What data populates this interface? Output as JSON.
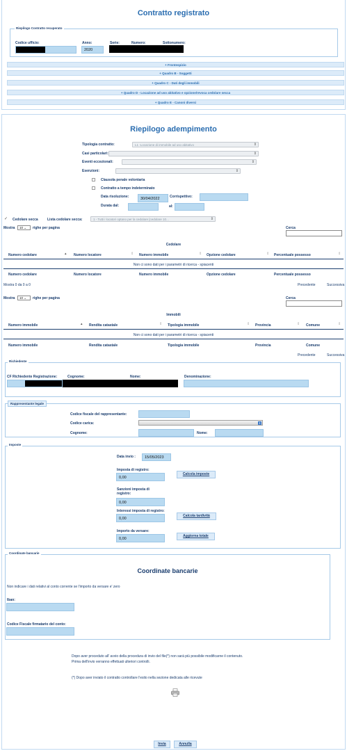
{
  "page": {
    "title": "Contratto registrato"
  },
  "riepilogo_contratto": {
    "legend": "Riepilogo Contratto recuperato",
    "codice_ufficio_label": "Codice ufficio:",
    "anno_label": "Anno:",
    "anno_value": "2020",
    "serie_label": "Serie:",
    "numero_label": "Numero:",
    "sottonumero_label": "Sottonumero:"
  },
  "accordions": [
    "+ Frontespizio",
    "+ Quadro B - Soggetti",
    "+ Quadro C - Dati degli immobili",
    "+ Quadro D - Locazione ad uso abitativo e opzione/revoca cedolare secca",
    "+ Quadro E - Canoni diversi"
  ],
  "adempimento": {
    "title": "Riepilogo adempimento",
    "tipologia_label": "Tipologia contratto:",
    "tipologia_value": "L1 -Locazione di immobile ad uso abitativo",
    "casi_label": "Casi particolari:",
    "eventi_label": "Eventi eccezionali:",
    "esenzioni_label": "Esenzioni:",
    "clausola_label": "Clausola penale volontaria",
    "tempo_label": "Contratto a tempo indeterminato",
    "data_risoluzione_label": "Data risoluzione:",
    "data_risoluzione_value": "30/04/2022",
    "corrispettivo_label": "Corrispettivo:",
    "durata_label": "Durata dal:",
    "al_label": "al:",
    "cedolare_label": "Cedolare secca",
    "lista_cedolare_label": "Lista cedolare secca:",
    "lista_cedolare_value": "1 - Tutti i locatori optano per la cedolare [cedolare 10..."
  },
  "table_cedolare": {
    "show_prefix": "Mostra",
    "page_size": "10",
    "show_suffix": "righe per pagina",
    "search_label": "Cerca",
    "title": "Cedolare",
    "columns": [
      "Numero cedolare",
      "Numero locatore",
      "Numero immobile",
      "Opzione cedolare",
      "Percentuale possesso"
    ],
    "empty": "Non ci sono dati per i parametri di ricerca - spiacenti",
    "info": "Mostra 0 da 0 a 0",
    "prev": "Precedente",
    "next": "Successiva"
  },
  "table_immobili": {
    "show_prefix": "Mostra",
    "page_size": "10",
    "show_suffix": "righe per pagina",
    "search_label": "Cerca",
    "title": "Immobili",
    "columns": [
      "Numero immobile",
      "Rendita catastale",
      "Tipologia immobile",
      "Provincia",
      "Comune"
    ],
    "empty": "Non ci sono dati per i parametri di ricerca - spiacenti",
    "prev": "Precedente",
    "next": "Successiva"
  },
  "richiedente": {
    "legend": "Richiedente",
    "cf_label": "CF Richiedente Registrazione:",
    "cognome_label": "Cognome:",
    "nome_label": "Nome:",
    "denominazione_label": "Denominazione:"
  },
  "rappresentante": {
    "legend": "Rappresentante legale",
    "cf_label": "Codice fiscale del rappresentante:",
    "carica_label": "Codice carica:",
    "cognome_label": "Cognome:",
    "nome_label": "Nome:"
  },
  "imposte": {
    "legend": "Imposte",
    "data_invio_label": "Data invio :",
    "data_invio_value": "15/05/2023",
    "imposta_label": "Imposta di registro:",
    "imposta_value": "0,00",
    "calcola_imposte": "Calcola imposte",
    "sanzioni_label": "Sanzioni imposta di registro:",
    "sanzioni_value": "0,00",
    "interessi_label": "Interessi imposta di registro:",
    "interessi_value": "0,00",
    "calcola_tardivita": "Calcola tardività",
    "importo_label": "Importo da versare:",
    "importo_value": "0,00",
    "aggiorna_totale": "Aggiorna totale"
  },
  "coordinate": {
    "legend": "Coordinate bancarie",
    "title": "Coordinate bancarie",
    "note": "Non indicare i dati relativi al conto corrente se l'importo da versare e' zero",
    "iban_label": "Iban:",
    "cf_label": "Codice Fiscale firmatario del conto:"
  },
  "footer": {
    "note1": "Dopo aver proceduto all' avvio della procedura di invio del file(*) non sarà più possibile modificarne il contenuto.",
    "note2": "Prima dell'invio verranno effettuati ulteriori controlli.",
    "note3": "(*) Dopo aver inviato il contratto controllare l'esito nella sezione dedicata alle ricevute",
    "invia": "Invia",
    "annulla": "Annulla"
  }
}
